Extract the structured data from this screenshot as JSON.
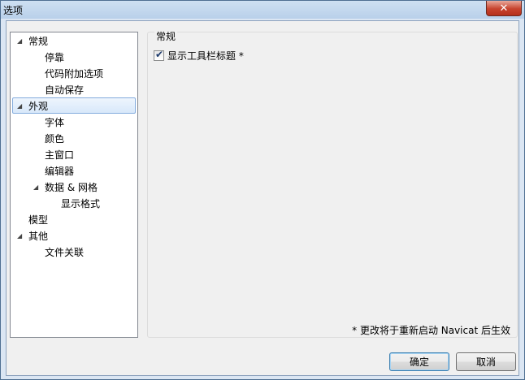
{
  "window": {
    "title": "选项",
    "close_glyph": "✕"
  },
  "tree": {
    "items": [
      {
        "label": "常规",
        "level": 0,
        "expanded": true,
        "selected": false
      },
      {
        "label": "停靠",
        "level": 1,
        "expanded": null,
        "selected": false
      },
      {
        "label": "代码附加选项",
        "level": 1,
        "expanded": null,
        "selected": false
      },
      {
        "label": "自动保存",
        "level": 1,
        "expanded": null,
        "selected": false
      },
      {
        "label": "外观",
        "level": 0,
        "expanded": true,
        "selected": true
      },
      {
        "label": "字体",
        "level": 1,
        "expanded": null,
        "selected": false
      },
      {
        "label": "颜色",
        "level": 1,
        "expanded": null,
        "selected": false
      },
      {
        "label": "主窗口",
        "level": 1,
        "expanded": null,
        "selected": false
      },
      {
        "label": "编辑器",
        "level": 1,
        "expanded": null,
        "selected": false
      },
      {
        "label": "数据 & 网格",
        "level": 1,
        "expanded": true,
        "selected": false
      },
      {
        "label": "显示格式",
        "level": 2,
        "expanded": null,
        "selected": false
      },
      {
        "label": "模型",
        "level": 0,
        "expanded": null,
        "selected": false
      },
      {
        "label": "其他",
        "level": 0,
        "expanded": true,
        "selected": false
      },
      {
        "label": "文件关联",
        "level": 1,
        "expanded": null,
        "selected": false
      }
    ],
    "expand_glyph": "◢"
  },
  "panel": {
    "group_title": "常规",
    "checkbox": {
      "label": "显示工具栏标题 *",
      "checked": true,
      "check_glyph": "✔"
    },
    "note": "* 更改将于重新启动 Navicat 后生效"
  },
  "buttons": {
    "ok": "确定",
    "cancel": "取消"
  }
}
